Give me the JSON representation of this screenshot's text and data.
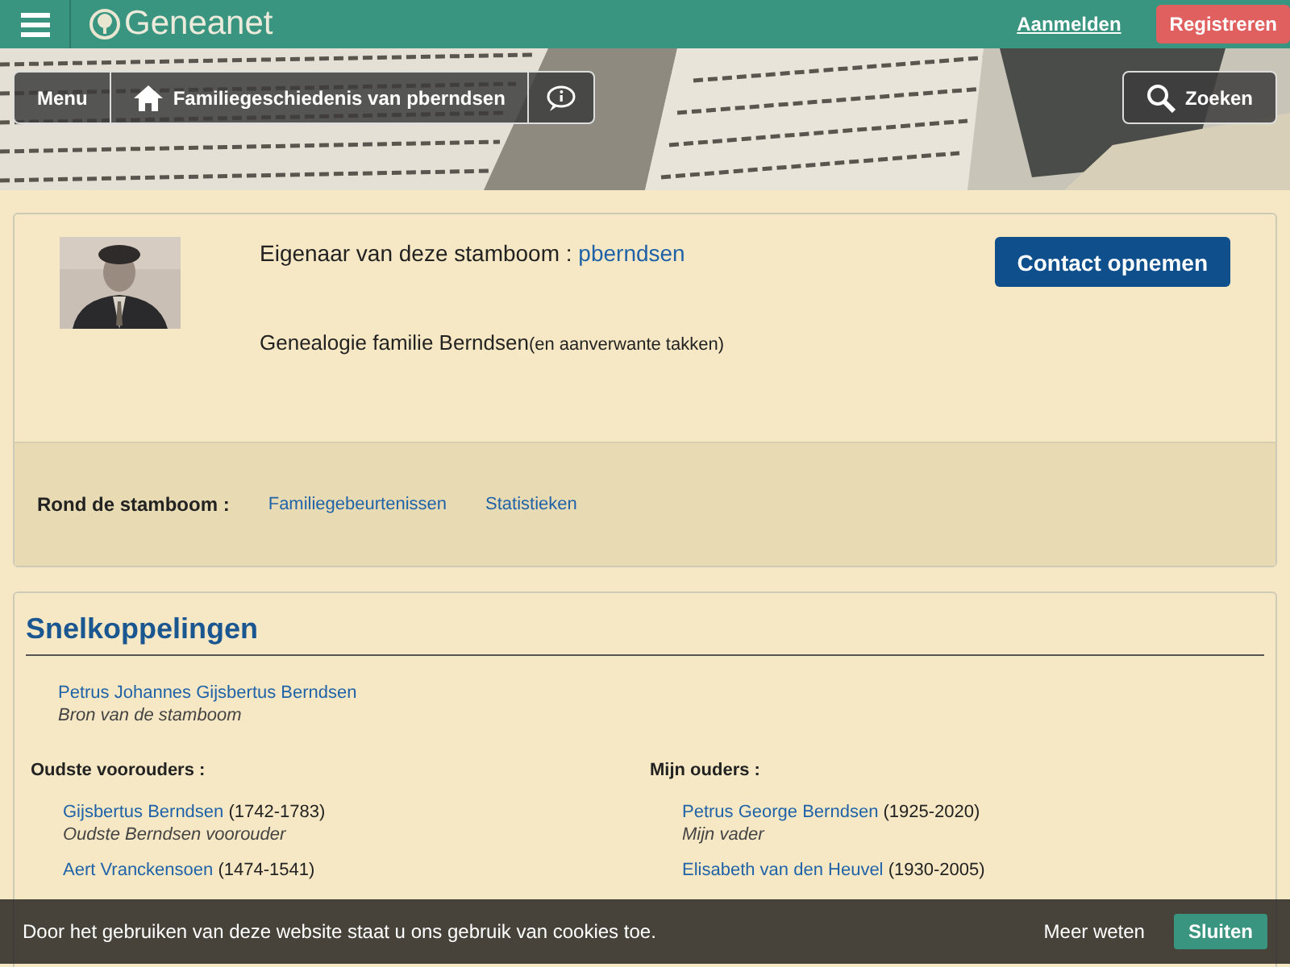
{
  "top_bar": {
    "logo": "Geneanet",
    "login": "Aanmelden",
    "register": "Registreren"
  },
  "hero_nav": {
    "menu": "Menu",
    "tree_title": "Familiegeschiedenis van pberndsen",
    "search": "Zoeken"
  },
  "owner_card": {
    "owner_label": "Eigenaar van deze stamboom :",
    "owner_link": "pberndsen",
    "contact_button": "Contact opnemen",
    "description": "Genealogie familie Berndsen",
    "description_note": "(en aanverwante takken)",
    "around_label": "Rond de stamboom :",
    "around_links": [
      "Familiegebeurtenissen",
      "Statistieken"
    ]
  },
  "quick_links": {
    "title": "Snelkoppelingen",
    "root_person": {
      "name": "Petrus Johannes Gijsbertus Berndsen",
      "role": "Bron van de stamboom"
    },
    "columns": [
      {
        "heading": "Oudste voorouders :",
        "people": [
          {
            "name": "Gijsbertus Berndsen",
            "years": "(1742-1783)",
            "role": "Oudste Berndsen voorouder"
          },
          {
            "name": "Aert Vranckensoen",
            "years": "(1474-1541)"
          }
        ]
      },
      {
        "heading": "Mijn ouders :",
        "people": [
          {
            "name": "Petrus George Berndsen",
            "years": "(1925-2020)",
            "role": "Mijn vader"
          },
          {
            "name": "Elisabeth van den Heuvel",
            "years": "(1930-2005)"
          }
        ]
      }
    ]
  },
  "cookie_bar": {
    "text": "Door het gebruiken van deze website staat u ons gebruik van cookies toe.",
    "more": "Meer weten",
    "close": "Sluiten"
  }
}
